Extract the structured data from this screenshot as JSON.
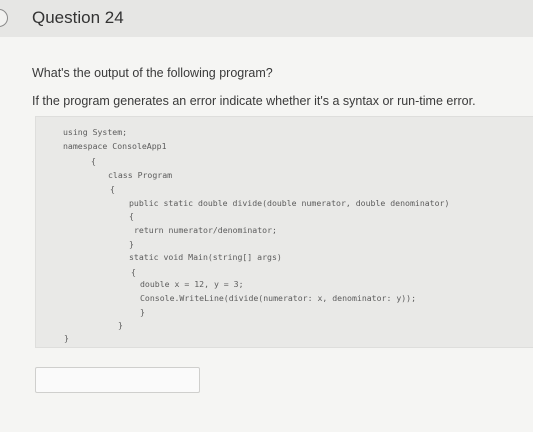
{
  "question": {
    "title": "Question 24",
    "prompt": "What's the output of the following program?",
    "instruction": "If the program generates an error indicate whether it's a syntax or run-time error."
  },
  "code": {
    "line1": "using System;",
    "line2": "namespace ConsoleApp1",
    "line3": "{",
    "line4": "class Program",
    "line5": "{",
    "line6": "public static double divide(double numerator, double denominator)",
    "line7": "{",
    "line8": "return numerator/denominator;",
    "line9": "}",
    "line10": "static void Main(string[] args)",
    "line11": "{",
    "line12": "double x = 12, y = 3;",
    "line13": "Console.WriteLine(divide(numerator: x, denominator: y));",
    "line14": "}",
    "line15": "}",
    "line16": "}"
  },
  "answer": {
    "value": "",
    "placeholder": ""
  },
  "icons": {
    "status": "circle-icon",
    "pointer": "mouse-cursor-icon"
  }
}
